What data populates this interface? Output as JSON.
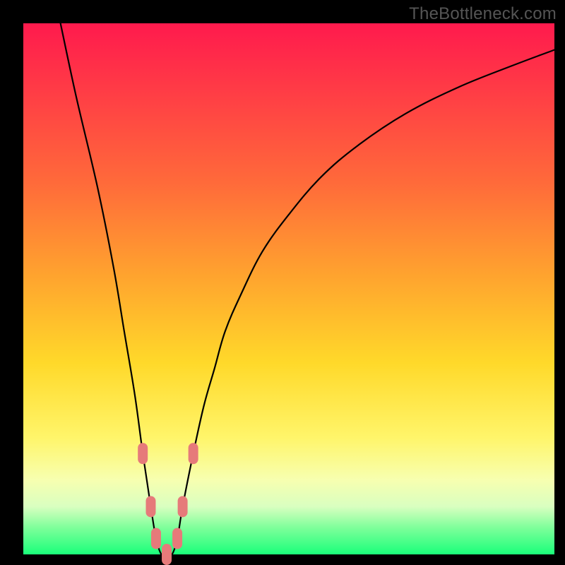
{
  "attribution": "TheBottleneck.com",
  "chart_data": {
    "type": "line",
    "title": "",
    "xlabel": "",
    "ylabel": "",
    "xlim": [
      0,
      100
    ],
    "ylim": [
      0,
      100
    ],
    "grid": false,
    "legend": false,
    "series": [
      {
        "name": "curve",
        "color": "#000000",
        "x": [
          7,
          10,
          14,
          17,
          19,
          21,
          22.5,
          24,
          25,
          26,
          27,
          28,
          29,
          30,
          32,
          34,
          36,
          38,
          41,
          45,
          50,
          56,
          63,
          72,
          82,
          92,
          100
        ],
        "values": [
          100,
          86,
          69,
          54,
          42,
          30,
          19,
          9,
          3,
          0,
          0,
          0,
          3,
          9,
          19,
          28,
          35,
          42,
          49,
          57,
          64,
          71,
          77,
          83,
          88,
          92,
          95
        ]
      }
    ],
    "markers": [
      {
        "x": 22.5,
        "y": 19,
        "color": "#e67a7a"
      },
      {
        "x": 24,
        "y": 9,
        "color": "#e67a7a"
      },
      {
        "x": 25,
        "y": 3,
        "color": "#e67a7a"
      },
      {
        "x": 27,
        "y": 0,
        "color": "#e67a7a"
      },
      {
        "x": 29,
        "y": 3,
        "color": "#e67a7a"
      },
      {
        "x": 30,
        "y": 9,
        "color": "#e67a7a"
      },
      {
        "x": 32,
        "y": 19,
        "color": "#e67a7a"
      }
    ]
  }
}
